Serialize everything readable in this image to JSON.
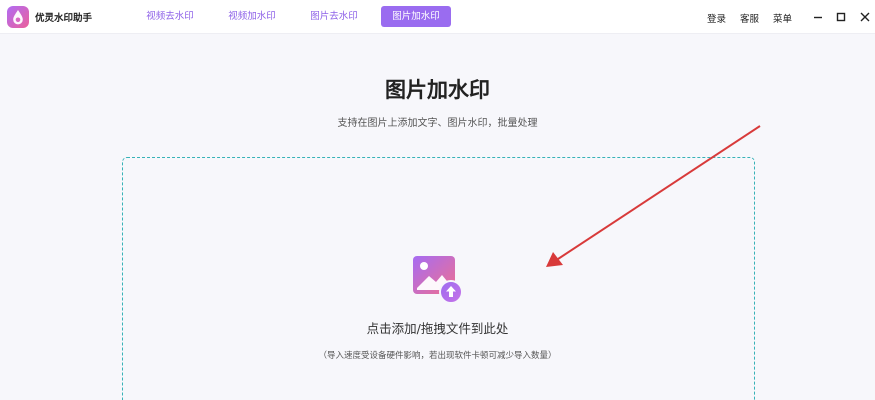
{
  "app": {
    "name": "优灵水印助手",
    "logo_icon": "water-drop-logo"
  },
  "tabs": [
    {
      "label": "视频去水印",
      "active": false
    },
    {
      "label": "视频加水印",
      "active": false
    },
    {
      "label": "图片去水印",
      "active": false
    },
    {
      "label": "图片加水印",
      "active": true
    }
  ],
  "header_links": {
    "login": "登录",
    "service": "客服",
    "menu": "菜单"
  },
  "window_controls": [
    "minimize-icon",
    "maximize-icon",
    "close-icon"
  ],
  "main": {
    "title": "图片加水印",
    "subtitle": "支持在图片上添加文字、图片水印，批量处理",
    "drop_text": "点击添加/拖拽文件到此处",
    "drop_hint": "（导入速度受设备硬件影响，若出现软件卡顿可减少导入数量）",
    "upload_icon": "image-upload-icon"
  },
  "colors": {
    "accent": "#9a6cf0",
    "tab_text": "#8e62e8",
    "dashed_border": "#37b2b7",
    "annotation_arrow": "#d83a3a",
    "background": "#f7f7fb"
  }
}
